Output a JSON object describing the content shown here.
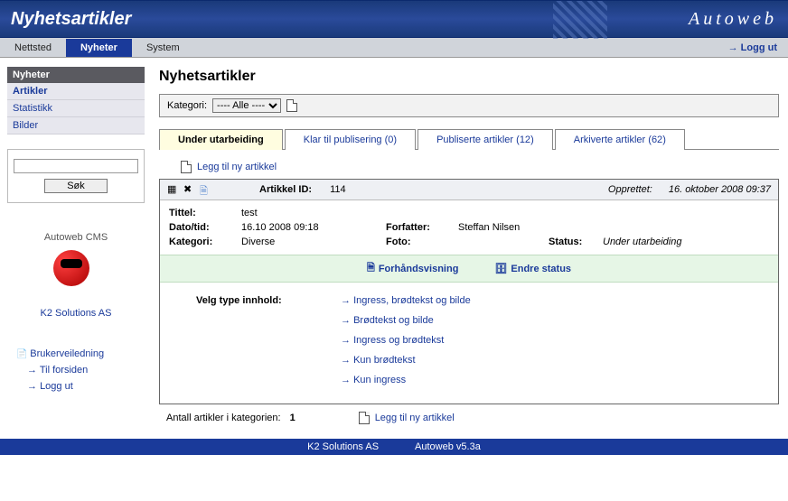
{
  "header": {
    "title": "Nyhetsartikler",
    "brand": "Autoweb"
  },
  "nav": {
    "items": [
      "Nettsted",
      "Nyheter",
      "System"
    ],
    "active_index": 1,
    "logout": "Logg ut"
  },
  "sidebar": {
    "box_title": "Nyheter",
    "items": [
      "Artikler",
      "Statistikk",
      "Bilder"
    ],
    "selected_index": 0,
    "search_btn": "Søk",
    "cms_label": "Autoweb CMS",
    "cms_link": "K2 Solutions AS",
    "links": {
      "guide": "Brukerveiledning",
      "home": "Til forsiden",
      "logout": "Logg ut"
    }
  },
  "main": {
    "heading": "Nyhetsartikler",
    "category_label": "Kategori:",
    "category_value": "---- Alle ----",
    "tabs": [
      {
        "label": "Under utarbeiding",
        "count": null
      },
      {
        "label": "Klar til publisering",
        "count": 0
      },
      {
        "label": "Publiserte artikler",
        "count": 12
      },
      {
        "label": "Arkiverte artikler",
        "count": 62
      }
    ],
    "active_tab": 0,
    "add_link": "Legg til ny artikkel",
    "article": {
      "id_label": "Artikkel ID:",
      "id": "114",
      "created_label": "Opprettet:",
      "created": "16. oktober 2008 09:37",
      "fields": {
        "title_lbl": "Tittel:",
        "title": "test",
        "date_lbl": "Dato/tid:",
        "date": "16.10 2008 09:18",
        "author_lbl": "Forfatter:",
        "author": "Steffan Nilsen",
        "cat_lbl": "Kategori:",
        "cat": "Diverse",
        "photo_lbl": "Foto:",
        "photo": "",
        "status_lbl": "Status:",
        "status": "Under utarbeiding"
      },
      "actions": {
        "preview": "Forhåndsvisning",
        "change_status": "Endre status"
      },
      "content_type_label": "Velg type innhold:",
      "content_types": [
        "Ingress, brødtekst og bilde",
        "Brødtekst og bilde",
        "Ingress og brødtekst",
        "Kun brødtekst",
        "Kun ingress"
      ]
    },
    "footer": {
      "count_label": "Antall artikler i kategorien:",
      "count": "1",
      "add_link": "Legg til ny artikkel"
    }
  },
  "bottom": {
    "company": "K2 Solutions AS",
    "version": "Autoweb v5.3a"
  }
}
